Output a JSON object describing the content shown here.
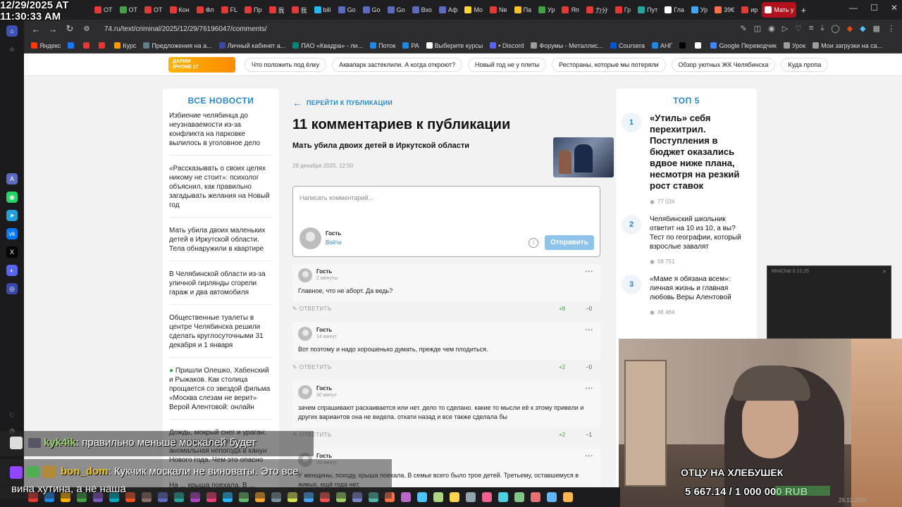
{
  "overlay": {
    "timestamp_date": "12/29/2025 AT",
    "timestamp_time": "11:30:33 AM",
    "chat": [
      {
        "user": "kyk4ik",
        "text": ": правильно меньше москалей будет"
      },
      {
        "user": "bon_dom",
        "text": ": Кукчик москали не виноваты. Это все"
      },
      {
        "user": "",
        "text": "вина хутина, а не наша"
      }
    ],
    "goal_title": "ОТЦУ НА ХЛЕБУШЕК",
    "goal_value": "5 667.14 / 1 000 000 RUB",
    "minichat_title": "MiniChat 0.12.25",
    "taskbar_date": "29.12.2025"
  },
  "browser": {
    "tabs": [
      {
        "label": "ОТ",
        "color": "#e53935"
      },
      {
        "label": "ОТ",
        "color": "#43a047"
      },
      {
        "label": "ОТ",
        "color": "#e53935"
      },
      {
        "label": "Кон",
        "color": "#e53935"
      },
      {
        "label": "Фл",
        "color": "#e53935"
      },
      {
        "label": "FL",
        "color": "#e53935"
      },
      {
        "label": "Пр",
        "color": "#e53935"
      },
      {
        "label": "我",
        "color": "#e53935"
      },
      {
        "label": "我",
        "color": "#e53935"
      },
      {
        "label": "bili",
        "color": "#29b6f6"
      },
      {
        "label": "Go",
        "color": "#5c6bc0"
      },
      {
        "label": "Go",
        "color": "#5c6bc0"
      },
      {
        "label": "Go",
        "color": "#5c6bc0"
      },
      {
        "label": "Вхо",
        "color": "#5c6bc0"
      },
      {
        "label": "Аф",
        "color": "#5c6bc0"
      },
      {
        "label": "Мо",
        "color": "#fdd835"
      },
      {
        "label": "Ne",
        "color": "#e53935"
      },
      {
        "label": "Па",
        "color": "#fbc02d"
      },
      {
        "label": "Ур",
        "color": "#43a047"
      },
      {
        "label": "Яп",
        "color": "#e53935"
      },
      {
        "label": "力分",
        "color": "#e53935"
      },
      {
        "label": "Гр",
        "color": "#e53935"
      },
      {
        "label": "Пут",
        "color": "#26a69a"
      },
      {
        "label": "Гла",
        "color": "#ffffff"
      },
      {
        "label": "Ур",
        "color": "#42a5f5"
      },
      {
        "label": "39€",
        "color": "#ff7043"
      },
      {
        "label": "ир",
        "color": "#e53935"
      },
      {
        "label": "Мать у",
        "color": "#ffffff"
      }
    ],
    "url": "74.ru/text/criminal/2025/12/29/76196047/comments/",
    "bookmarks": [
      {
        "label": "Яндекс",
        "color": "#ff3d00"
      },
      {
        "label": "",
        "color": "#1877f2"
      },
      {
        "label": "",
        "color": "#e53935"
      },
      {
        "label": "",
        "color": "#e53935"
      },
      {
        "label": "Курс",
        "color": "#ff9800"
      },
      {
        "label": "Предложения на а...",
        "color": "#607d8b"
      },
      {
        "label": "Личный кабинет а...",
        "color": "#3949ab"
      },
      {
        "label": "ПАО «Квадра» - ли...",
        "color": "#00897b"
      },
      {
        "label": "Поток",
        "color": "#1e88e5"
      },
      {
        "label": "PA",
        "color": "#1e88e5"
      },
      {
        "label": "Выберите курсы",
        "color": "#ffffff"
      },
      {
        "label": "• Discord",
        "color": "#5865f2"
      },
      {
        "label": "Форумы - Металлис...",
        "color": "#9e9e9e"
      },
      {
        "label": "Coursera",
        "color": "#0056d2"
      },
      {
        "label": "АНГ",
        "color": "#1e88e5"
      },
      {
        "label": "",
        "color": "#000000"
      },
      {
        "label": "",
        "color": "#ffffff"
      },
      {
        "label": "Google Переводчик",
        "color": "#4285f4"
      },
      {
        "label": "Урок",
        "color": "#9e9e9e"
      },
      {
        "label": "Мои загрузки на са...",
        "color": "#9e9e9e"
      }
    ]
  },
  "promo": {
    "badge_line1": "ДАРИМ",
    "badge_line2": "IPHONE 17",
    "chips": [
      "Что положить под ёлку",
      "Аквапарк застеклили. А когда откроют?",
      "Новый год не у плиты",
      "Рестораны, которые мы потеряли",
      "Обзор уютных ЖК Челябинска",
      "Куда пропа"
    ]
  },
  "left": {
    "heading": "ВСЕ НОВОСТИ",
    "news": [
      "Избиение челябинца до неузнаваемости из-за конфликта на парковке вылилось в уголовное дело",
      "«Рассказывать о своих целях никому не стоит»: психолог объяснил, как правильно загадывать желания на Новый год",
      "Мать убила двоих маленьких детей в Иркутской области. Тела обнаружили в квартире",
      "В Челябинской области из-за уличной гирлянды сгорели гараж и два автомобиля",
      "Общественные туалеты в центре Челябинска решили сделать круглосуточными 31 декабря и 1 января",
      "Пришли Олешко, Хабенский и Рыжаков. Как столица прощается со звездой фильма «Москва слезам не верит» Верой Алентовой: онлайн",
      "Дождь, мокрый снег и ураган: на города обрушится аномальная непогода в канун Нового года. Чем это опасно",
      "На ... крыша поехала. В ... отопление во всех"
    ]
  },
  "main": {
    "back_label": "ПЕРЕЙТИ К ПУБЛИКАЦИИ",
    "title": "11 комментариев к публикации",
    "article_title": "Мать убила двоих детей в Иркутской области",
    "article_date": "29 декабря 2025, 12:50",
    "comment_placeholder": "Написать комментарий...",
    "guest_name": "Гость",
    "login_label": "Войти",
    "send_label": "Отправить",
    "reply_label": "ОТВЕТИТЬ",
    "comments": [
      {
        "author": "Гость",
        "time": "2 минуты",
        "text": "Главное, что не аборт. Да ведь?",
        "up": "+8",
        "down": "−0"
      },
      {
        "author": "Гость",
        "time": "14 минут",
        "text": "Вот поэтому и надо хорошенько думать, прежде чем плодиться.",
        "up": "+2",
        "down": "−0"
      },
      {
        "author": "Гость",
        "time": "30 минут",
        "text": "зачем спрашивают раскаивается или нет. дело то сделано. какие то мысли её к этому привели и других вариантов она не видела. откати назад и все также сделала бы",
        "up": "+2",
        "down": "−1"
      },
      {
        "author": "Гость",
        "time": "29 минут",
        "text": "У женщины, походу, крыша поехала. В семье всего было трое детей. Третьему, оставшемуся в живых, ещё года нет.",
        "up": "",
        "down": ""
      }
    ]
  },
  "right": {
    "heading": "ТОП 5",
    "items": [
      {
        "num": "1",
        "title": "«Утиль» себя перехитрил. Поступления в бюджет оказались вдвое ниже плана, несмотря на резкий рост ставок",
        "views": "77 034"
      },
      {
        "num": "2",
        "title": "Челябинский школьник ответит на 10 из 10, а вы? Тест по географии, который взрослые завалят",
        "views": "58 751"
      },
      {
        "num": "3",
        "title": "«Маме я обязана всем»: личная жизнь и главная любовь Веры Алентовой",
        "views": "46 464"
      }
    ]
  }
}
